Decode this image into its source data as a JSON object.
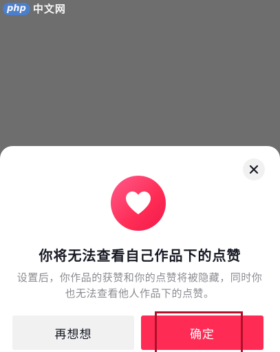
{
  "watermark": {
    "logo_text": "php",
    "site_text": "中文网"
  },
  "dialog": {
    "close_icon": "close-icon",
    "heart_icon": "heart-icon",
    "title": "你将无法查看自己作品下的点赞",
    "description": "设置后，你作品的获赞和你的点赞将被隐藏，同时你也无法查看他人作品下的点赞。",
    "cancel_label": "再想想",
    "confirm_label": "确定"
  },
  "colors": {
    "accent": "#fe2c55",
    "overlay": "#6e6e6e",
    "highlight_border": "#b0102a"
  }
}
